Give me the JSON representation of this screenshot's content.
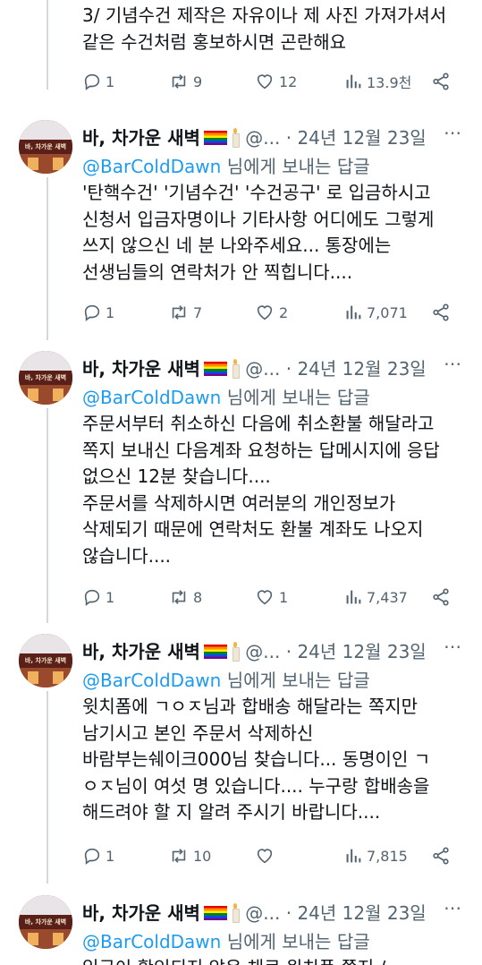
{
  "tweets": [
    {
      "text_lines": [
        "3/ 기념수건 제작은 자유이나 제 사진 가져가셔서",
        "같은 수건처럼 홍보하시면 곤란해요"
      ],
      "stats": {
        "replies": "1",
        "reposts": "9",
        "likes": "12",
        "views": "13.9천"
      }
    },
    {
      "author": "바, 차가운 새벽",
      "handle": "@...",
      "date": "· 24년 12월 23일",
      "mention": "@BarColdDawn",
      "reply_suffix": " 님에게 보내는 답글",
      "text_lines": [
        "'탄핵수건' '기념수건' '수건공구' 로 입금하시고",
        "신청서 입금자명이나 기타사항 어디에도 그렇게",
        "쓰지 않으신 네 분 나와주세요... 통장에는",
        "선생님들의 연락처가 안 찍힙니다...."
      ],
      "stats": {
        "replies": "1",
        "reposts": "7",
        "likes": "2",
        "views": "7,071"
      }
    },
    {
      "author": "바, 차가운 새벽",
      "handle": "@...",
      "date": "· 24년 12월 23일",
      "mention": "@BarColdDawn",
      "reply_suffix": " 님에게 보내는 답글",
      "text_lines": [
        "주문서부터 취소하신 다음에 취소환불 해달라고",
        "쪽지 보내신 다음계좌 요청하는 답메시지에 응답",
        "없으신 12분 찾습니다....",
        "주문서를 삭제하시면 여러분의 개인정보가",
        "삭제되기 때문에 연락처도 환불 계좌도 나오지",
        "않습니다...."
      ],
      "stats": {
        "replies": "1",
        "reposts": "8",
        "likes": "1",
        "views": "7,437"
      }
    },
    {
      "author": "바, 차가운 새벽",
      "handle": "@...",
      "date": "· 24년 12월 23일",
      "mention": "@BarColdDawn",
      "reply_suffix": " 님에게 보내는 답글",
      "text_lines": [
        "윗치폼에 ㄱㅇㅈ님과 합배송 해달라는 쪽지만",
        "남기시고 본인 주문서 삭제하신",
        "바람부는쉐이크000님 찾습니다... 동명이인 ㄱ",
        "ㅇㅈ님이 여섯 명 있습니다.... 누구랑 합배송을",
        "해드려야 할 지 알려 주시기 바랍니다...."
      ],
      "stats": {
        "replies": "1",
        "reposts": "10",
        "likes": "",
        "views": "7,815"
      }
    },
    {
      "author": "바, 차가운 새벽",
      "handle": "@...",
      "date": "· 24년 12월 23일",
      "mention": "@BarColdDawn",
      "reply_suffix": " 님에게 보내는 답글",
      "text_lines": [
        "입금이 확인되지 않은 채로 윗치폼 쪽지 /"
      ]
    }
  ],
  "avatar_sign": "바, 차가운 새벽",
  "more_icon": "⋯",
  "icons": [
    "reply-icon",
    "repost-icon",
    "like-icon",
    "views-icon",
    "share-icon",
    "more-icon"
  ],
  "colors": {
    "text": "#0f1419",
    "muted": "#536471",
    "mention": "#1d9bf0",
    "thread_line": "#cfd9de"
  }
}
